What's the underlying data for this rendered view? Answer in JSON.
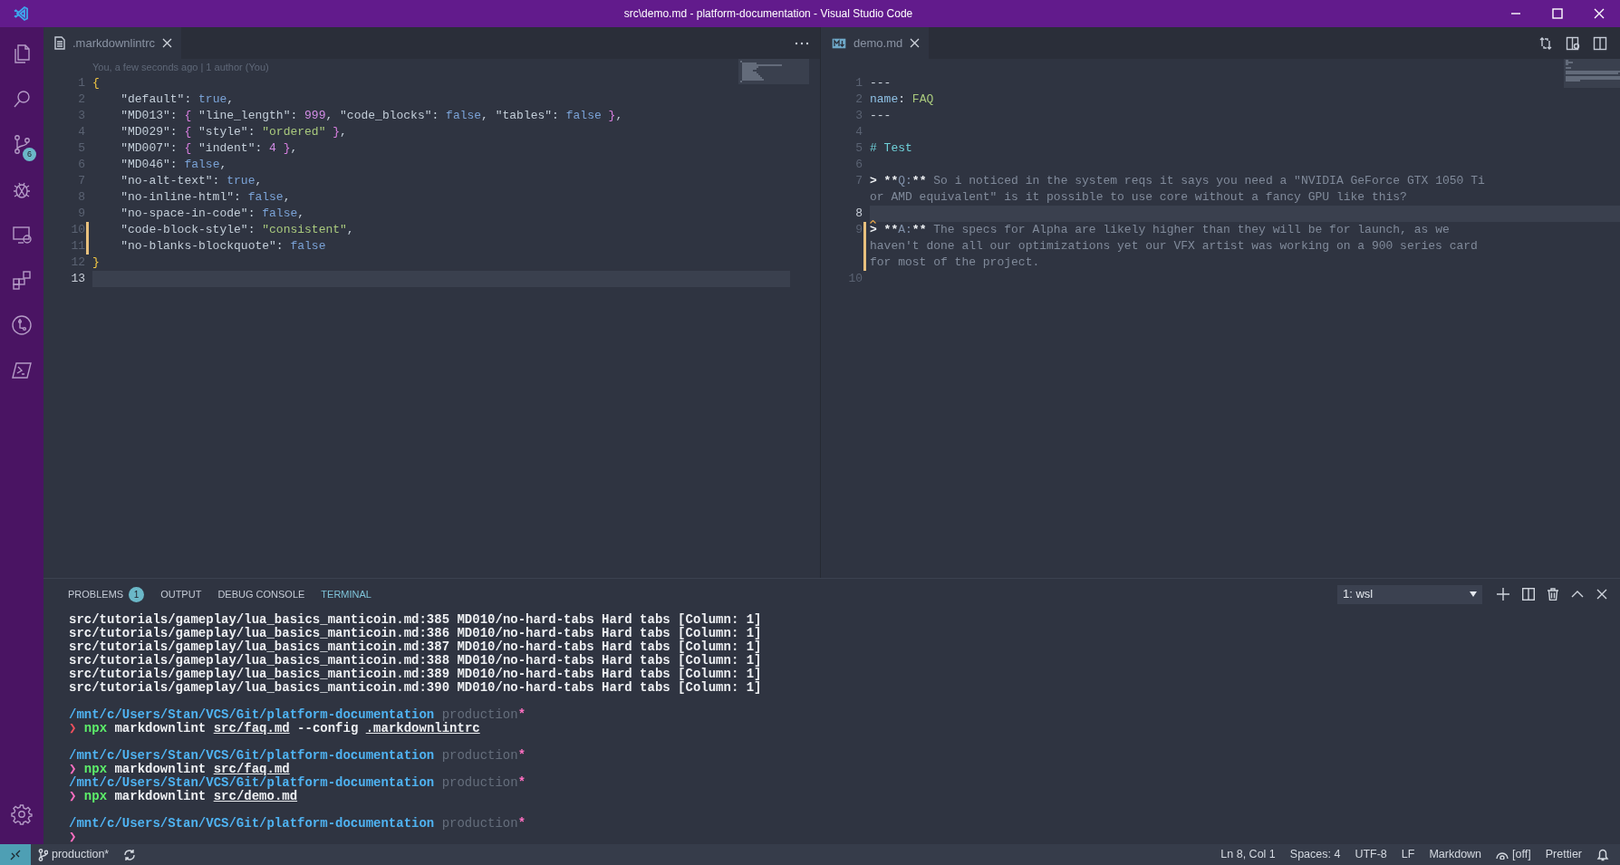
{
  "window": {
    "title": "src\\demo.md - platform-documentation - Visual Studio Code"
  },
  "activity_bar": [
    {
      "kind": "explorer"
    },
    {
      "kind": "search"
    },
    {
      "kind": "source-control",
      "badge": "6"
    },
    {
      "kind": "debug"
    },
    {
      "kind": "remote"
    },
    {
      "kind": "extensions"
    },
    {
      "kind": "git-graph"
    },
    {
      "kind": "powershell"
    }
  ],
  "editor_groups": [
    {
      "tabs": [
        {
          "label": ".markdownlintrc",
          "kind": "file",
          "selected": true
        }
      ],
      "codelens": "You, a few seconds ago | 1 author (You)",
      "lines": [
        {
          "n": "1",
          "modified": false,
          "current": false,
          "rows": [
            [
              {
                "kind": "brace-1",
                "text": "{"
              }
            ]
          ]
        },
        {
          "n": "2",
          "modified": false,
          "current": false,
          "rows": [
            [
              {
                "kind": "text",
                "text": "    \"default\": "
              },
              {
                "kind": "literal",
                "text": "true"
              },
              {
                "kind": "text",
                "text": ","
              }
            ]
          ]
        },
        {
          "n": "3",
          "modified": false,
          "current": false,
          "rows": [
            [
              {
                "kind": "text",
                "text": "    \"MD013\": "
              },
              {
                "kind": "brace-2",
                "text": "{"
              },
              {
                "kind": "text",
                "text": " \"line_length\": "
              },
              {
                "kind": "number",
                "text": "999"
              },
              {
                "kind": "text",
                "text": ", \"code_blocks\": "
              },
              {
                "kind": "literal",
                "text": "false"
              },
              {
                "kind": "text",
                "text": ", \"tables\": "
              },
              {
                "kind": "literal",
                "text": "false"
              },
              {
                "kind": "text",
                "text": " "
              },
              {
                "kind": "brace-2",
                "text": "}"
              },
              {
                "kind": "text",
                "text": ","
              }
            ]
          ]
        },
        {
          "n": "4",
          "modified": false,
          "current": false,
          "rows": [
            [
              {
                "kind": "text",
                "text": "    \"MD029\": "
              },
              {
                "kind": "brace-2",
                "text": "{"
              },
              {
                "kind": "text",
                "text": " \"style\": "
              },
              {
                "kind": "string",
                "text": "\"ordered\""
              },
              {
                "kind": "text",
                "text": " "
              },
              {
                "kind": "brace-2",
                "text": "}"
              },
              {
                "kind": "text",
                "text": ","
              }
            ]
          ]
        },
        {
          "n": "5",
          "modified": false,
          "current": false,
          "rows": [
            [
              {
                "kind": "text",
                "text": "    \"MD007\": "
              },
              {
                "kind": "brace-2",
                "text": "{"
              },
              {
                "kind": "text",
                "text": " \"indent\": "
              },
              {
                "kind": "number",
                "text": "4"
              },
              {
                "kind": "text",
                "text": " "
              },
              {
                "kind": "brace-2",
                "text": "}"
              },
              {
                "kind": "text",
                "text": ","
              }
            ]
          ]
        },
        {
          "n": "6",
          "modified": false,
          "current": false,
          "rows": [
            [
              {
                "kind": "text",
                "text": "    \"MD046\": "
              },
              {
                "kind": "literal",
                "text": "false"
              },
              {
                "kind": "text",
                "text": ","
              }
            ]
          ]
        },
        {
          "n": "7",
          "modified": false,
          "current": false,
          "rows": [
            [
              {
                "kind": "text",
                "text": "    \"no-alt-text\": "
              },
              {
                "kind": "literal",
                "text": "true"
              },
              {
                "kind": "text",
                "text": ","
              }
            ]
          ]
        },
        {
          "n": "8",
          "modified": false,
          "current": false,
          "rows": [
            [
              {
                "kind": "text",
                "text": "    \"no-inline-html\": "
              },
              {
                "kind": "literal",
                "text": "false"
              },
              {
                "kind": "text",
                "text": ","
              }
            ]
          ]
        },
        {
          "n": "9",
          "modified": false,
          "current": false,
          "rows": [
            [
              {
                "kind": "text",
                "text": "    \"no-space-in-code\": "
              },
              {
                "kind": "literal",
                "text": "false"
              },
              {
                "kind": "text",
                "text": ","
              }
            ]
          ]
        },
        {
          "n": "10",
          "modified": true,
          "current": false,
          "rows": [
            [
              {
                "kind": "text",
                "text": "    \"code-block-style\": "
              },
              {
                "kind": "string",
                "text": "\"consistent\""
              },
              {
                "kind": "text",
                "text": ","
              }
            ]
          ]
        },
        {
          "n": "11",
          "modified": true,
          "current": false,
          "rows": [
            [
              {
                "kind": "text",
                "text": "    \"no-blanks-blockquote\": "
              },
              {
                "kind": "literal",
                "text": "false"
              }
            ]
          ]
        },
        {
          "n": "12",
          "modified": false,
          "current": false,
          "rows": [
            [
              {
                "kind": "brace-1",
                "text": "}"
              }
            ]
          ]
        },
        {
          "n": "13",
          "modified": false,
          "current": true
        }
      ]
    },
    {
      "tabs": [
        {
          "label": "demo.md",
          "kind": "markdown",
          "selected": true
        }
      ],
      "lines": [
        {
          "n": "1",
          "modified": false,
          "current": false,
          "warning": false,
          "rows": [
            [
              {
                "kind": "hr",
                "text": "---"
              }
            ]
          ]
        },
        {
          "n": "2",
          "modified": false,
          "current": false,
          "warning": false,
          "rows": [
            [
              {
                "kind": "key",
                "text": "name"
              },
              {
                "kind": "hr",
                "text": ": "
              },
              {
                "kind": "string",
                "text": "FAQ"
              }
            ]
          ]
        },
        {
          "n": "3",
          "modified": false,
          "current": false,
          "warning": false,
          "rows": [
            [
              {
                "kind": "hr",
                "text": "---"
              }
            ]
          ]
        },
        {
          "n": "4",
          "modified": false,
          "current": false,
          "warning": false
        },
        {
          "n": "5",
          "modified": false,
          "current": false,
          "warning": false,
          "rows": [
            [
              {
                "kind": "heading",
                "text": "# Test"
              }
            ]
          ]
        },
        {
          "n": "6",
          "modified": false,
          "current": false,
          "warning": false
        },
        {
          "n": "7",
          "modified": false,
          "current": false,
          "warning": false,
          "rows": [
            [
              {
                "kind": "mark",
                "text": "> **"
              },
              {
                "kind": "label",
                "text": "Q:"
              },
              {
                "kind": "mark",
                "text": "**"
              },
              {
                "kind": "quote",
                "text": " So i noticed in the system reqs it says you need a \"NVIDIA GeForce GTX 1050 Ti"
              }
            ],
            [
              {
                "kind": "quote",
                "text": "or AMD equivalent\" is it possible to use core without a fancy GPU like this?"
              }
            ]
          ]
        },
        {
          "n": "8",
          "modified": false,
          "current": true,
          "warning": true
        },
        {
          "n": "9",
          "modified": true,
          "current": false,
          "warning": false,
          "rows": [
            [
              {
                "kind": "mark",
                "text": "> **"
              },
              {
                "kind": "label",
                "text": "A:"
              },
              {
                "kind": "mark",
                "text": "**"
              },
              {
                "kind": "quote",
                "text": " The specs for Alpha are likely higher than they will be for launch, as we"
              }
            ],
            [
              {
                "kind": "quote",
                "text": "haven't done all our optimizations yet our VFX artist was working on a 900 series card"
              }
            ],
            [
              {
                "kind": "quote",
                "text": "for most of the project."
              }
            ]
          ]
        },
        {
          "n": "10",
          "modified": false,
          "current": false,
          "warning": false
        }
      ]
    }
  ],
  "panel": {
    "tabs": [
      {
        "label": "PROBLEMS",
        "badge": "1",
        "selected": false
      },
      {
        "label": "OUTPUT",
        "selected": false
      },
      {
        "label": "DEBUG CONSOLE",
        "selected": false
      },
      {
        "label": "TERMINAL",
        "selected": true
      }
    ],
    "terminal_select": "1: wsl",
    "terminal_groups": [
      [
        [
          {
            "kind": "out",
            "text": "src/tutorials/gameplay/lua_basics_manticoin.md:385 MD010/no-hard-tabs Hard tabs [Column: 1]"
          }
        ],
        [
          {
            "kind": "out",
            "text": "src/tutorials/gameplay/lua_basics_manticoin.md:386 MD010/no-hard-tabs Hard tabs [Column: 1]"
          }
        ],
        [
          {
            "kind": "out",
            "text": "src/tutorials/gameplay/lua_basics_manticoin.md:387 MD010/no-hard-tabs Hard tabs [Column: 1]"
          }
        ],
        [
          {
            "kind": "out",
            "text": "src/tutorials/gameplay/lua_basics_manticoin.md:388 MD010/no-hard-tabs Hard tabs [Column: 1]"
          }
        ],
        [
          {
            "kind": "out",
            "text": "src/tutorials/gameplay/lua_basics_manticoin.md:389 MD010/no-hard-tabs Hard tabs [Column: 1]"
          }
        ],
        [
          {
            "kind": "out",
            "text": "src/tutorials/gameplay/lua_basics_manticoin.md:390 MD010/no-hard-tabs Hard tabs [Column: 1]"
          }
        ]
      ],
      [
        [
          {
            "kind": "path",
            "text": "/mnt/c/Users/Stan/VCS/Git/platform-documentation"
          },
          {
            "kind": "branch",
            "text": "production"
          },
          {
            "kind": "dirty",
            "text": "*"
          }
        ],
        [
          {
            "kind": "prompt-error",
            "text": "❯"
          },
          {
            "kind": "cmd",
            "text": "npx"
          },
          {
            "kind": "out",
            "text": " markdownlint "
          },
          {
            "kind": "arg",
            "text": "src/faq.md"
          },
          {
            "kind": "out",
            "text": " --config "
          },
          {
            "kind": "arg",
            "text": ".markdownlintrc"
          }
        ]
      ],
      [
        [
          {
            "kind": "path",
            "text": "/mnt/c/Users/Stan/VCS/Git/platform-documentation"
          },
          {
            "kind": "branch",
            "text": "production"
          },
          {
            "kind": "dirty",
            "text": "*"
          }
        ],
        [
          {
            "kind": "prompt",
            "text": "❯"
          },
          {
            "kind": "cmd",
            "text": "npx"
          },
          {
            "kind": "out",
            "text": " markdownlint "
          },
          {
            "kind": "arg",
            "text": "src/faq.md"
          }
        ],
        [
          {
            "kind": "path",
            "text": "/mnt/c/Users/Stan/VCS/Git/platform-documentation"
          },
          {
            "kind": "branch",
            "text": "production"
          },
          {
            "kind": "dirty",
            "text": "*"
          }
        ],
        [
          {
            "kind": "prompt",
            "text": "❯"
          },
          {
            "kind": "cmd",
            "text": "npx"
          },
          {
            "kind": "out",
            "text": " markdownlint "
          },
          {
            "kind": "arg",
            "text": "src/demo.md"
          }
        ]
      ],
      [
        [
          {
            "kind": "path",
            "text": "/mnt/c/Users/Stan/VCS/Git/platform-documentation"
          },
          {
            "kind": "branch",
            "text": "production"
          },
          {
            "kind": "dirty",
            "text": "*"
          }
        ],
        [
          {
            "kind": "prompt",
            "text": "❯"
          }
        ]
      ]
    ]
  },
  "status_bar": {
    "branch": "production*",
    "items": [
      {
        "kind": "text",
        "text": "Ln 8, Col 1"
      },
      {
        "kind": "text",
        "text": "Spaces: 4"
      },
      {
        "kind": "text",
        "text": "UTF-8"
      },
      {
        "kind": "text",
        "text": "LF"
      },
      {
        "kind": "text",
        "text": "Markdown"
      },
      {
        "kind": "watch",
        "text": "[off]"
      },
      {
        "kind": "text",
        "text": "Prettier"
      }
    ]
  }
}
